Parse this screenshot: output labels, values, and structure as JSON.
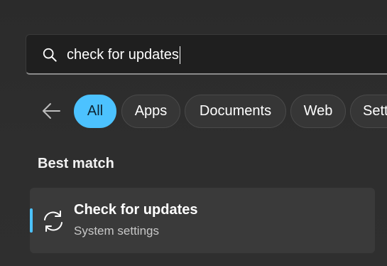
{
  "search": {
    "query": "check for updates"
  },
  "filters": {
    "items": [
      {
        "label": "All",
        "active": true
      },
      {
        "label": "Apps",
        "active": false
      },
      {
        "label": "Documents",
        "active": false
      },
      {
        "label": "Web",
        "active": false
      },
      {
        "label": "Setti",
        "active": false
      }
    ]
  },
  "best_match": {
    "heading": "Best match",
    "result": {
      "title": "Check for updates",
      "subtitle": "System settings",
      "icon": "sync-icon"
    }
  },
  "colors": {
    "accent": "#4cc2ff",
    "background": "#2c2c2c",
    "card": "#3a3a3a"
  }
}
